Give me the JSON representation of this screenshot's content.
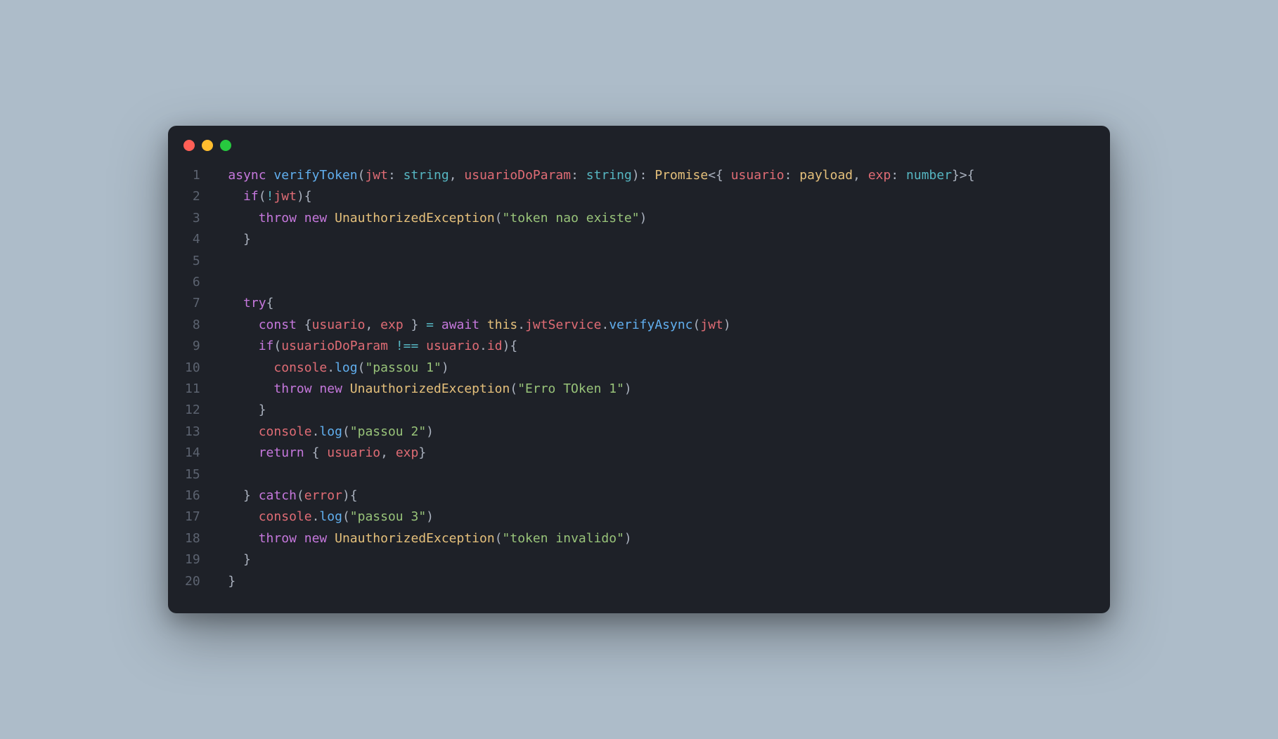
{
  "window": {
    "dots": [
      "red",
      "yellow",
      "green"
    ]
  },
  "code": {
    "lineCount": 20,
    "tokens": [
      [
        {
          "t": "  ",
          "c": ""
        },
        {
          "t": "async",
          "c": "tok-kw"
        },
        {
          "t": " ",
          "c": ""
        },
        {
          "t": "verifyToken",
          "c": "tok-fn"
        },
        {
          "t": "(",
          "c": "tok-punc"
        },
        {
          "t": "jwt",
          "c": "tok-var"
        },
        {
          "t": ": ",
          "c": "tok-punc"
        },
        {
          "t": "string",
          "c": "tok-type"
        },
        {
          "t": ", ",
          "c": "tok-punc"
        },
        {
          "t": "usuarioDoParam",
          "c": "tok-var"
        },
        {
          "t": ": ",
          "c": "tok-punc"
        },
        {
          "t": "string",
          "c": "tok-type"
        },
        {
          "t": "): ",
          "c": "tok-punc"
        },
        {
          "t": "Promise",
          "c": "tok-def"
        },
        {
          "t": "<{ ",
          "c": "tok-punc"
        },
        {
          "t": "usuario",
          "c": "tok-var"
        },
        {
          "t": ": ",
          "c": "tok-punc"
        },
        {
          "t": "payload",
          "c": "tok-def"
        },
        {
          "t": ", ",
          "c": "tok-punc"
        },
        {
          "t": "exp",
          "c": "tok-var"
        },
        {
          "t": ": ",
          "c": "tok-punc"
        },
        {
          "t": "number",
          "c": "tok-type"
        },
        {
          "t": "}>{",
          "c": "tok-punc"
        }
      ],
      [
        {
          "t": "    ",
          "c": ""
        },
        {
          "t": "if",
          "c": "tok-kw"
        },
        {
          "t": "(",
          "c": "tok-punc"
        },
        {
          "t": "!",
          "c": "tok-op"
        },
        {
          "t": "jwt",
          "c": "tok-var"
        },
        {
          "t": "){",
          "c": "tok-punc"
        }
      ],
      [
        {
          "t": "      ",
          "c": ""
        },
        {
          "t": "throw",
          "c": "tok-kw"
        },
        {
          "t": " ",
          "c": ""
        },
        {
          "t": "new",
          "c": "tok-kw"
        },
        {
          "t": " ",
          "c": ""
        },
        {
          "t": "UnauthorizedException",
          "c": "tok-def"
        },
        {
          "t": "(",
          "c": "tok-punc"
        },
        {
          "t": "\"token nao existe\"",
          "c": "tok-str"
        },
        {
          "t": ")",
          "c": "tok-punc"
        }
      ],
      [
        {
          "t": "    }",
          "c": "tok-punc"
        }
      ],
      [
        {
          "t": "",
          "c": ""
        }
      ],
      [
        {
          "t": "",
          "c": ""
        }
      ],
      [
        {
          "t": "    ",
          "c": ""
        },
        {
          "t": "try",
          "c": "tok-kw"
        },
        {
          "t": "{",
          "c": "tok-punc"
        }
      ],
      [
        {
          "t": "      ",
          "c": ""
        },
        {
          "t": "const",
          "c": "tok-kw"
        },
        {
          "t": " {",
          "c": "tok-punc"
        },
        {
          "t": "usuario",
          "c": "tok-var"
        },
        {
          "t": ", ",
          "c": "tok-punc"
        },
        {
          "t": "exp",
          "c": "tok-var"
        },
        {
          "t": " } ",
          "c": "tok-punc"
        },
        {
          "t": "=",
          "c": "tok-op"
        },
        {
          "t": " ",
          "c": ""
        },
        {
          "t": "await",
          "c": "tok-kw"
        },
        {
          "t": " ",
          "c": ""
        },
        {
          "t": "this",
          "c": "tok-this"
        },
        {
          "t": ".",
          "c": "tok-punc"
        },
        {
          "t": "jwtService",
          "c": "tok-prop"
        },
        {
          "t": ".",
          "c": "tok-punc"
        },
        {
          "t": "verifyAsync",
          "c": "tok-fn"
        },
        {
          "t": "(",
          "c": "tok-punc"
        },
        {
          "t": "jwt",
          "c": "tok-var"
        },
        {
          "t": ")",
          "c": "tok-punc"
        }
      ],
      [
        {
          "t": "      ",
          "c": ""
        },
        {
          "t": "if",
          "c": "tok-kw"
        },
        {
          "t": "(",
          "c": "tok-punc"
        },
        {
          "t": "usuarioDoParam",
          "c": "tok-var"
        },
        {
          "t": " ",
          "c": ""
        },
        {
          "t": "!==",
          "c": "tok-op"
        },
        {
          "t": " ",
          "c": ""
        },
        {
          "t": "usuario",
          "c": "tok-var"
        },
        {
          "t": ".",
          "c": "tok-punc"
        },
        {
          "t": "id",
          "c": "tok-prop"
        },
        {
          "t": "){",
          "c": "tok-punc"
        }
      ],
      [
        {
          "t": "        ",
          "c": ""
        },
        {
          "t": "console",
          "c": "tok-var"
        },
        {
          "t": ".",
          "c": "tok-punc"
        },
        {
          "t": "log",
          "c": "tok-fn"
        },
        {
          "t": "(",
          "c": "tok-punc"
        },
        {
          "t": "\"passou 1\"",
          "c": "tok-str"
        },
        {
          "t": ")",
          "c": "tok-punc"
        }
      ],
      [
        {
          "t": "        ",
          "c": ""
        },
        {
          "t": "throw",
          "c": "tok-kw"
        },
        {
          "t": " ",
          "c": ""
        },
        {
          "t": "new",
          "c": "tok-kw"
        },
        {
          "t": " ",
          "c": ""
        },
        {
          "t": "UnauthorizedException",
          "c": "tok-def"
        },
        {
          "t": "(",
          "c": "tok-punc"
        },
        {
          "t": "\"Erro TOken 1\"",
          "c": "tok-str"
        },
        {
          "t": ")",
          "c": "tok-punc"
        }
      ],
      [
        {
          "t": "      }",
          "c": "tok-punc"
        }
      ],
      [
        {
          "t": "      ",
          "c": ""
        },
        {
          "t": "console",
          "c": "tok-var"
        },
        {
          "t": ".",
          "c": "tok-punc"
        },
        {
          "t": "log",
          "c": "tok-fn"
        },
        {
          "t": "(",
          "c": "tok-punc"
        },
        {
          "t": "\"passou 2\"",
          "c": "tok-str"
        },
        {
          "t": ")",
          "c": "tok-punc"
        }
      ],
      [
        {
          "t": "      ",
          "c": ""
        },
        {
          "t": "return",
          "c": "tok-kw"
        },
        {
          "t": " { ",
          "c": "tok-punc"
        },
        {
          "t": "usuario",
          "c": "tok-var"
        },
        {
          "t": ", ",
          "c": "tok-punc"
        },
        {
          "t": "exp",
          "c": "tok-var"
        },
        {
          "t": "}",
          "c": "tok-punc"
        }
      ],
      [
        {
          "t": "",
          "c": ""
        }
      ],
      [
        {
          "t": "    } ",
          "c": "tok-punc"
        },
        {
          "t": "catch",
          "c": "tok-kw"
        },
        {
          "t": "(",
          "c": "tok-punc"
        },
        {
          "t": "error",
          "c": "tok-var"
        },
        {
          "t": "){",
          "c": "tok-punc"
        }
      ],
      [
        {
          "t": "      ",
          "c": ""
        },
        {
          "t": "console",
          "c": "tok-var"
        },
        {
          "t": ".",
          "c": "tok-punc"
        },
        {
          "t": "log",
          "c": "tok-fn"
        },
        {
          "t": "(",
          "c": "tok-punc"
        },
        {
          "t": "\"passou 3\"",
          "c": "tok-str"
        },
        {
          "t": ")",
          "c": "tok-punc"
        }
      ],
      [
        {
          "t": "      ",
          "c": ""
        },
        {
          "t": "throw",
          "c": "tok-kw"
        },
        {
          "t": " ",
          "c": ""
        },
        {
          "t": "new",
          "c": "tok-kw"
        },
        {
          "t": " ",
          "c": ""
        },
        {
          "t": "UnauthorizedException",
          "c": "tok-def"
        },
        {
          "t": "(",
          "c": "tok-punc"
        },
        {
          "t": "\"token invalido\"",
          "c": "tok-str"
        },
        {
          "t": ")",
          "c": "tok-punc"
        }
      ],
      [
        {
          "t": "    }",
          "c": "tok-punc"
        }
      ],
      [
        {
          "t": "  }",
          "c": "tok-punc"
        }
      ]
    ]
  }
}
